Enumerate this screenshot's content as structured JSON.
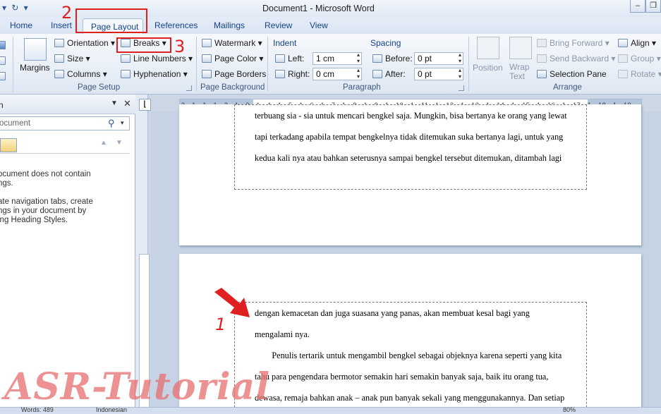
{
  "app": {
    "title": "Document1  -  Microsoft Word",
    "window_buttons": [
      "–",
      "❐",
      "✕"
    ],
    "qat": [
      "▾",
      "↻",
      "▾"
    ]
  },
  "tabs": [
    "Home",
    "Insert",
    "Page Layout",
    "References",
    "Mailings",
    "Review",
    "View"
  ],
  "active_tab": "Page Layout",
  "ribbon": {
    "page_setup": {
      "group": "Page Setup",
      "margins": "Margins",
      "orientation": "Orientation",
      "size": "Size",
      "columns": "Columns",
      "breaks": "Breaks",
      "line_numbers": "Line Numbers",
      "hyphenation": "Hyphenation"
    },
    "page_background": {
      "group": "Page Background",
      "watermark": "Watermark",
      "page_color": "Page Color",
      "page_borders": "Page Borders"
    },
    "paragraph": {
      "group": "Paragraph",
      "indent": "Indent",
      "left_label": "Left:",
      "left_value": "1 cm",
      "right_label": "Right:",
      "right_value": "0 cm",
      "spacing": "Spacing",
      "before_label": "Before:",
      "before_value": "0 pt",
      "after_label": "After:",
      "after_value": "0 pt"
    },
    "arrange": {
      "group": "Arrange",
      "position": "Position",
      "wrap_text": "Wrap\nText",
      "bring_forward": "Bring Forward",
      "send_backward": "Send Backward",
      "selection_pane": "Selection Pane",
      "align": "Align",
      "group_btn": "Group",
      "rotate": "Rotate"
    }
  },
  "nav": {
    "title": "n",
    "search_placeholder": "ocument",
    "msg1": [
      "ocument does not contain",
      "ngs."
    ],
    "msg2": [
      "ate navigation tabs, create",
      "ngs in your document by",
      "ing Heading Styles."
    ]
  },
  "ruler_numbers": "2 · 1 · 1 · 1 · 2 · 1 · 3 · 1 · 4 · 1 · 5 · 1 · 6 · 1 · 7 · 1 · 8 · 1 · 9 · 1 · 10 · 1 · 11 · 1 · 12 · 1 · 13 · 1 · 14 · 1 · 15 · 1 · 16 · 1 · 17 · 1 · 18 · 1 · 19",
  "page1_lines": [
    "terbuang sia - sia untuk mencari bengkel saja. Mungkin, bisa bertanya ke orang yang lewat",
    "tapi terkadang apabila tempat bengkelnya tidak ditemukan suka bertanya lagi, untuk yang",
    "kedua kali nya atau bahkan seterusnya sampai bengkel tersebut ditemukan, ditambah lagi"
  ],
  "page2_lines": [
    "dengan  kemacetan  dan  juga  suasana  yang  panas,  akan  membuat  kesal  bagi  yang",
    "mengalami nya.",
    "        Penulis tertarik untuk mengambil bengkel sebagai objeknya karena seperti yang kita",
    "tahu para pengendara bermotor semakin hari semakin banyak saja, baik itu orang tua,",
    "dewasa, remaja bahkan anak – anak pun banyak sekali yang menggunakannya. Dan setiap"
  ],
  "status": {
    "words": "Words: 489",
    "language": "Indonesian",
    "zoom": "80%"
  },
  "annotations": {
    "n1": "1",
    "n2": "2",
    "n3": "3"
  },
  "watermark": "ASR-Tutorial",
  "colors": {
    "annotation": "#e02020",
    "ribbon": "#dfe8f4"
  }
}
